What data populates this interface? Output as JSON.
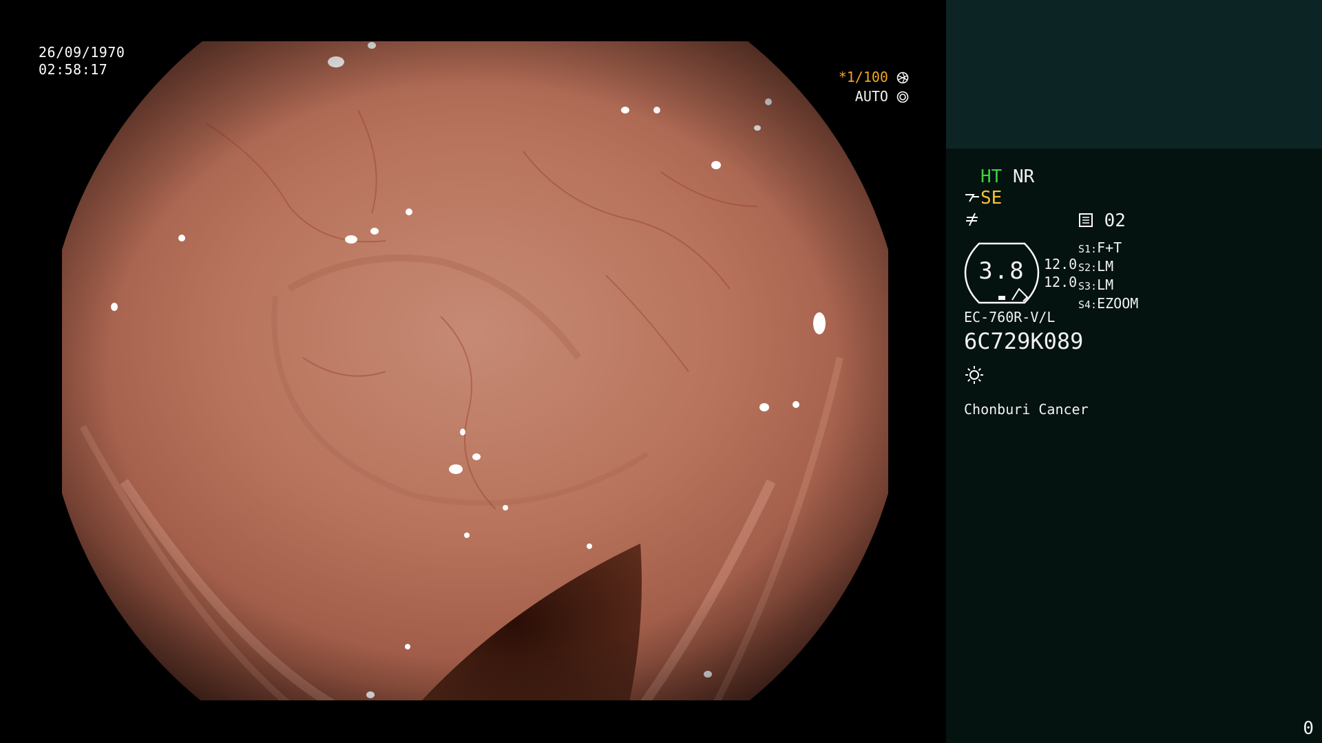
{
  "overlay": {
    "date": "26/09/1970",
    "time": "02:58:17",
    "shutter_prefix": "*",
    "shutter": "1/100",
    "shutter_icon": "shutter-icon",
    "iris_mode": "AUTO",
    "iris_icon": "iris-icon"
  },
  "panel": {
    "ht_label": "HT",
    "nr_label": "NR",
    "se_label": "SE",
    "se_icon": "structure-enhance-icon",
    "freeze_icon": "freeze-icon",
    "memory_icon": "memory-card-icon",
    "memory_count": "02",
    "zoom_value": "3.8",
    "zoom_sub_top": "12.0",
    "zoom_sub_bottom": "12.0",
    "switches": [
      {
        "key": "S1:",
        "value": "F+T"
      },
      {
        "key": "S2:",
        "value": "LM"
      },
      {
        "key": "S3:",
        "value": "LM"
      },
      {
        "key": "S4:",
        "value": "EZOOM"
      }
    ],
    "scope_model": "EC-760R-V/L",
    "serial": "6C729K089",
    "light_icon": "light-source-icon",
    "hospital": "Chonburi Cancer",
    "page_number": "0"
  },
  "colors": {
    "panel_bg": "#041210",
    "panel_top_bg": "#0d2424",
    "ht_color": "#3ed33e",
    "se_color": "#f7c531",
    "shutter_color": "#f5a623"
  }
}
